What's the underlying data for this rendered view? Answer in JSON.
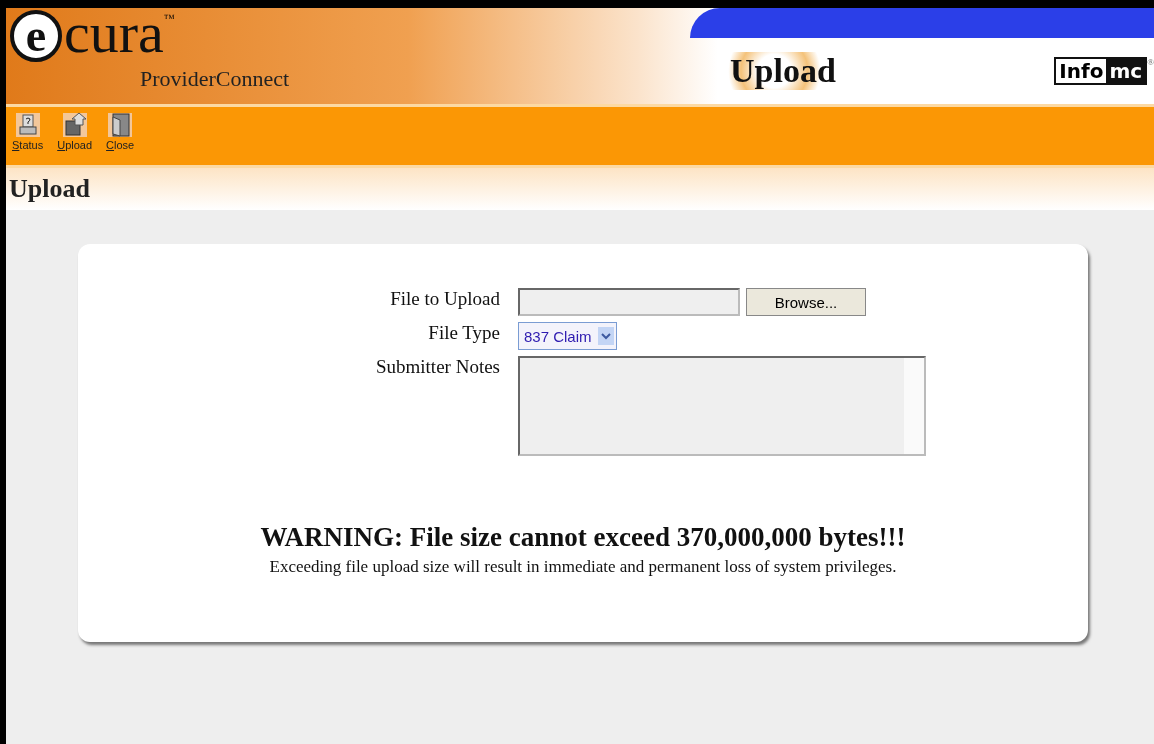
{
  "header": {
    "logo_letter": "e",
    "logo_word": "cura",
    "logo_tm": "™",
    "logo_subtitle": "ProviderConnect",
    "page_banner": "Upload",
    "brand_left": "Info",
    "brand_right": "mc",
    "brand_mark": "®"
  },
  "toolbar": [
    {
      "label": "Status",
      "kind": "status"
    },
    {
      "label": "Upload",
      "kind": "upload"
    },
    {
      "label": "Close",
      "kind": "close"
    }
  ],
  "page_title": "Upload",
  "form": {
    "file_label": "File to Upload",
    "browse_button": "Browse...",
    "type_label": "File Type",
    "type_value": "837 Claim",
    "notes_label": "Submitter Notes"
  },
  "warning": {
    "title": "WARNING: File size cannot exceed 370,000,000 bytes!!!",
    "text": "Exceeding file upload size will result in immediate and permanent loss of system privileges."
  }
}
